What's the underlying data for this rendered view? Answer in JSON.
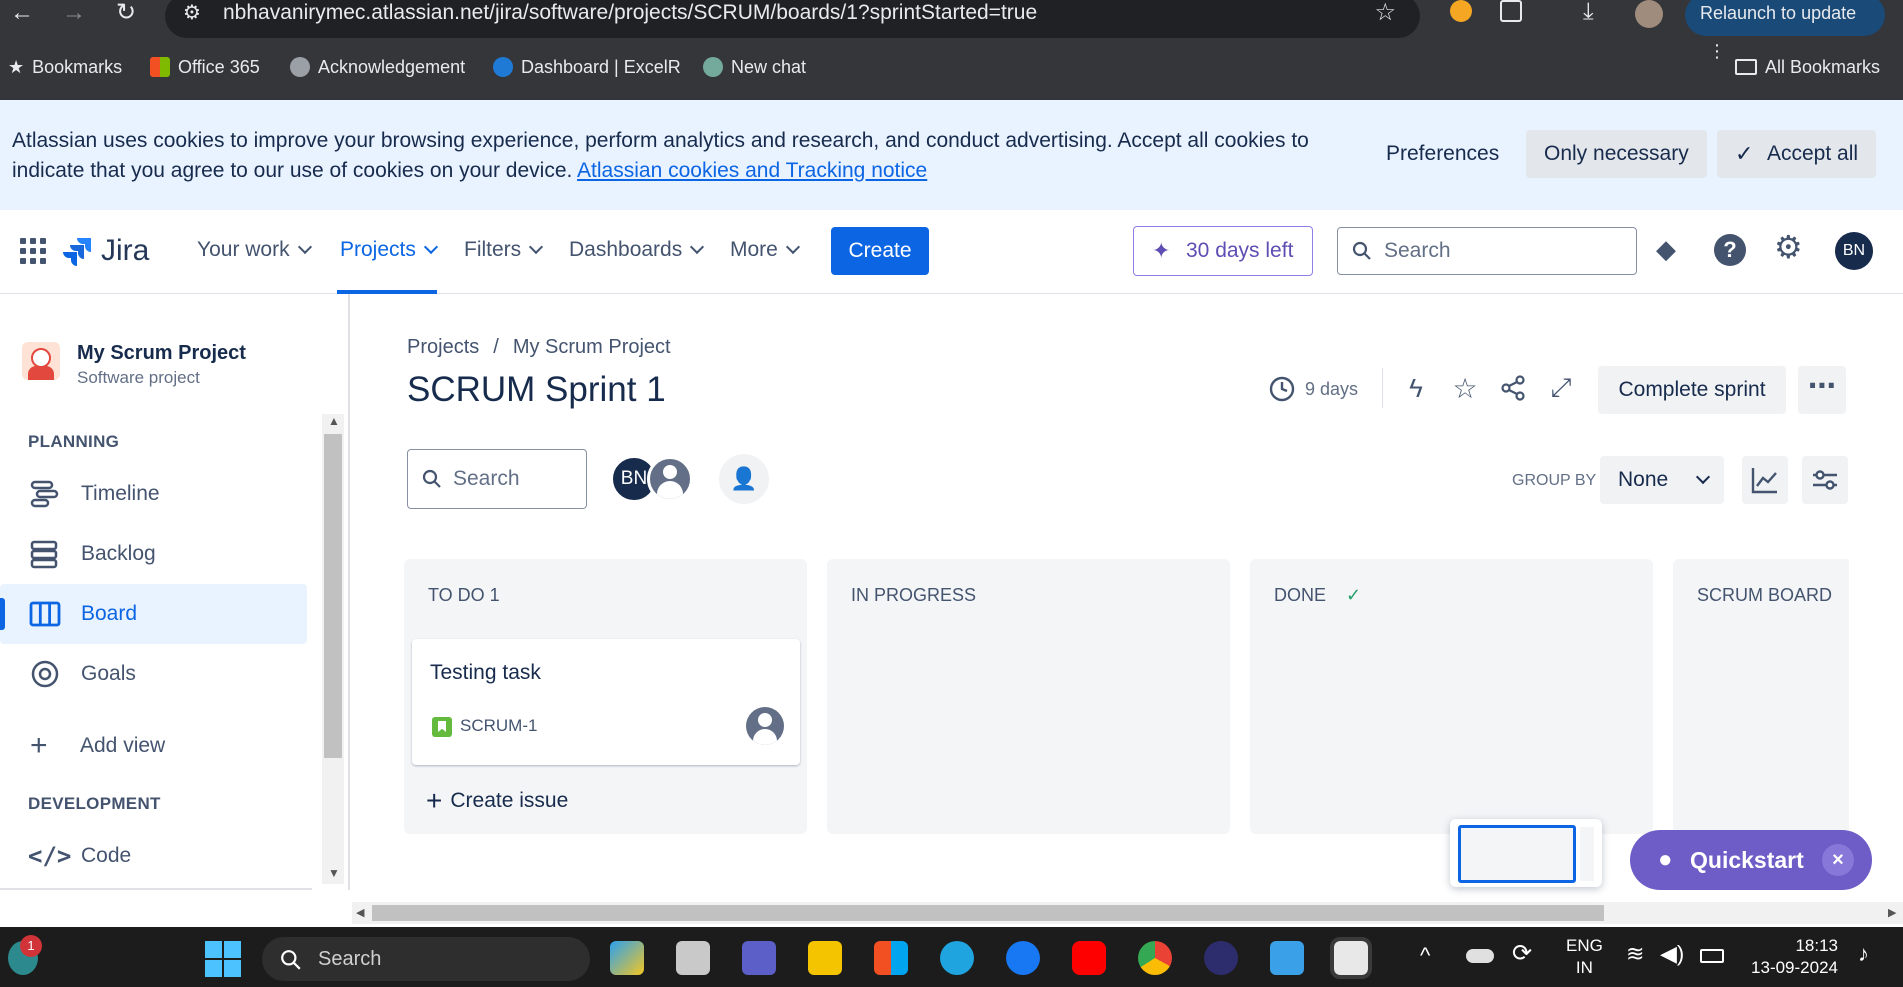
{
  "browser": {
    "url": "nbhavanirymec.atlassian.net/jira/software/projects/SCRUM/boards/1?sprintStarted=true",
    "relaunch_label": "Relaunch to update",
    "bookmarks": [
      {
        "label": "Bookmarks",
        "icon": "star-icon"
      },
      {
        "label": "Office 365",
        "icon": "office-icon"
      },
      {
        "label": "Acknowledgement",
        "icon": "globe-icon"
      },
      {
        "label": "Dashboard | ExcelR",
        "icon": "excelr-icon"
      },
      {
        "label": "New chat",
        "icon": "chatgpt-icon"
      }
    ],
    "all_bookmarks_label": "All Bookmarks"
  },
  "cookie_banner": {
    "text": "Atlassian uses cookies to improve your browsing experience, perform analytics and research, and conduct advertising. Accept all cookies to indicate that you agree to our use of cookies on your device.",
    "link": "Atlassian cookies and Tracking notice",
    "preferences": "Preferences",
    "only_necessary": "Only necessary",
    "accept_all": "Accept all"
  },
  "topnav": {
    "logo": "Jira",
    "items": [
      "Your work",
      "Projects",
      "Filters",
      "Dashboards",
      "More"
    ],
    "active": "Projects",
    "create": "Create",
    "trial": "30 days left",
    "search_placeholder": "Search",
    "avatar": "BN"
  },
  "sidebar": {
    "project_name": "My Scrum Project",
    "project_type": "Software project",
    "planning_heading": "PLANNING",
    "planning_items": [
      "Timeline",
      "Backlog",
      "Board",
      "Goals"
    ],
    "active_item": "Board",
    "add_view": "Add view",
    "development_heading": "DEVELOPMENT",
    "dev_items": [
      "Code"
    ]
  },
  "board": {
    "breadcrumb": [
      "Projects",
      "My Scrum Project"
    ],
    "breadcrumb_sep": "/",
    "title": "SCRUM Sprint 1",
    "days": "9 days",
    "complete_sprint": "Complete sprint",
    "search_placeholder": "Search",
    "avatar": "BN",
    "group_by_label": "GROUP BY",
    "group_by_value": "None",
    "columns": [
      {
        "title": "TO DO 1"
      },
      {
        "title": "IN PROGRESS"
      },
      {
        "title": "DONE"
      },
      {
        "title": "SCRUM BOARD"
      }
    ],
    "card": {
      "title": "Testing task",
      "key": "SCRUM-1"
    },
    "create_issue": "Create issue",
    "quickstart": "Quickstart"
  },
  "taskbar": {
    "search_placeholder": "Search",
    "notification_count": "1",
    "lang_top": "ENG",
    "lang_bottom": "IN",
    "time": "18:13",
    "date": "13-09-2024"
  },
  "colors": {
    "brand_blue": "#0c66e4",
    "quickstart_purple": "#6e5dc6",
    "done_green": "#22a06b"
  }
}
